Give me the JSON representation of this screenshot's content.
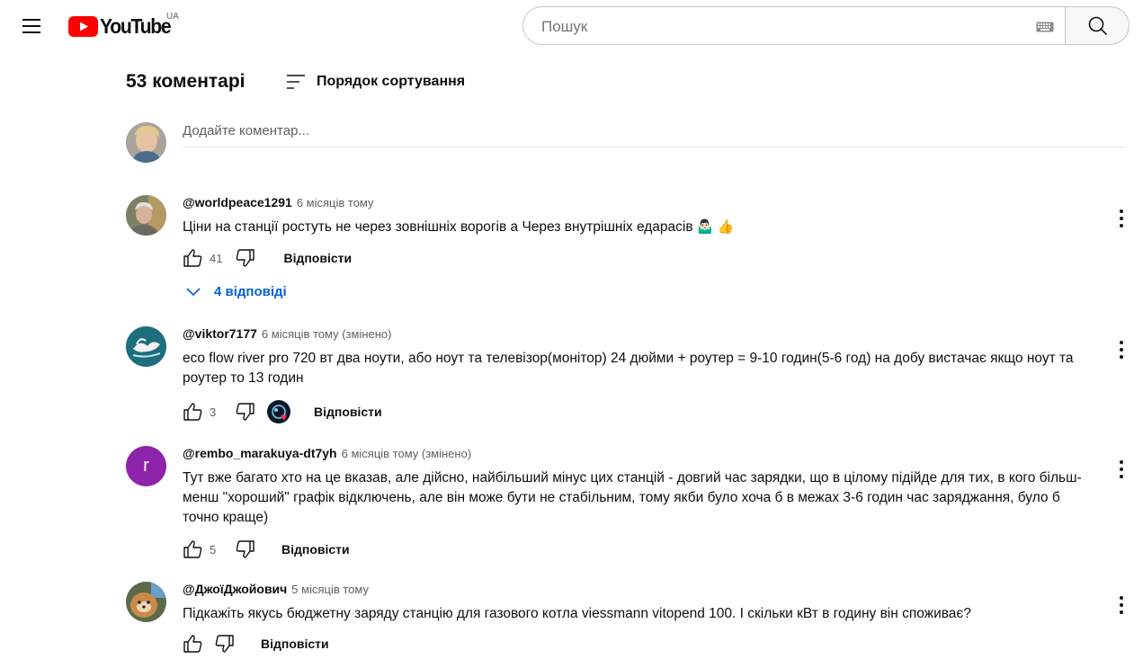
{
  "header": {
    "logo_text": "YouTube",
    "country_code": "UA",
    "search_placeholder": "Пошук",
    "icons": [
      "menu-icon",
      "youtube-logo",
      "keyboard-icon",
      "search-icon"
    ]
  },
  "comments_header": {
    "count_label": "53 коментарі",
    "sort_label": "Порядок сортування",
    "add_comment_placeholder": "Додайте коментар..."
  },
  "comments": [
    {
      "author": "@worldpeace1291",
      "time": "6 місяців тому",
      "text": "Ціни на станції ростуть не через зовнішніх ворогів а Через внутрішніх едарасів",
      "emoji": "🤷🏻‍♂️ 👍",
      "likes": "41",
      "reply_label": "Відповісти",
      "replies_label": "4 відповіді"
    },
    {
      "author": "@viktor7177",
      "time": "6 місяців тому (змінено)",
      "text": "eco flow river pro 720 вт два ноути, або ноут та телевізор(монітор) 24 дюйми + роутер = 9-10 годин(5-6 год) на добу вистачає якщо ноут та роутер то 13 годин",
      "likes": "3",
      "reply_label": "Відповісти"
    },
    {
      "author": "@rembo_marakuya-dt7yh",
      "time": "6 місяців тому (змінено)",
      "avatar_letter": "r",
      "avatar_color": "#8e24aa",
      "text": "Тут вже багато хто на це вказав, але дійсно, найбільший мінус цих станцій - довгий час зарядки, що в цілому підійде для тих, в кого більш-менш \"хороший\" графік відключень, але він може бути не стабільним, тому якби було хоча б в межах 3-6 годин час заряджання, було б точно краще)",
      "likes": "5",
      "reply_label": "Відповісти"
    },
    {
      "author": "@ДжоїДжойович",
      "time": "5 місяців тому",
      "text": "Підкажіть якусь бюджетну заряду станцію для газового котла viessmann vitopend 100. І скільки кВт в годину він споживає?",
      "likes": "",
      "reply_label": "Відповісти"
    }
  ],
  "colors": {
    "youtube_red": "#ff0000",
    "link_blue": "#065fd4",
    "secondary_text": "#606060"
  }
}
